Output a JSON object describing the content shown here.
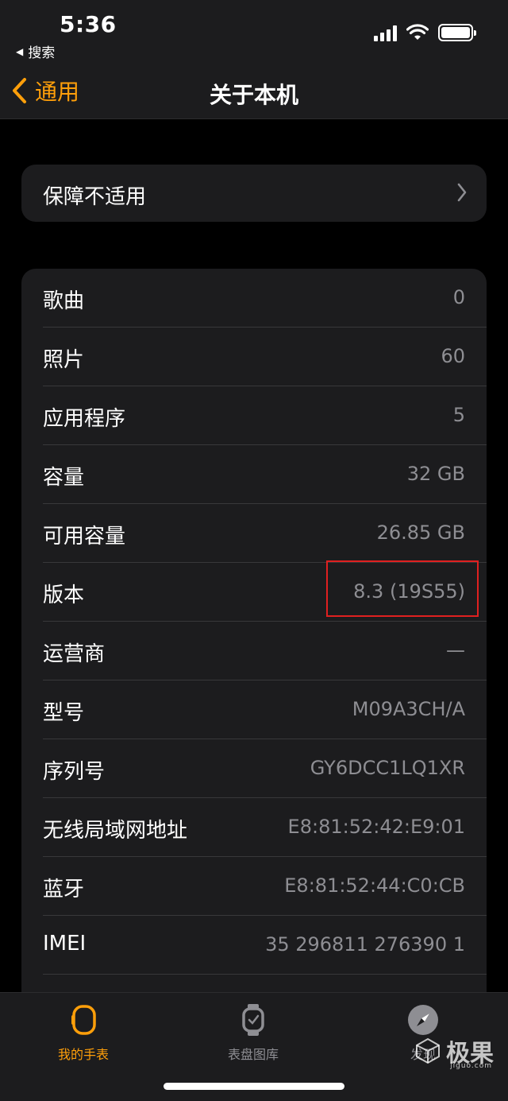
{
  "status": {
    "time": "5:36",
    "back_app": "搜索"
  },
  "nav": {
    "back_label": "通用",
    "title": "关于本机"
  },
  "warranty": {
    "label": "保障不适用"
  },
  "info_rows": [
    {
      "key": "歌曲",
      "value": "0"
    },
    {
      "key": "照片",
      "value": "60"
    },
    {
      "key": "应用程序",
      "value": "5"
    },
    {
      "key": "容量",
      "value": "32 GB"
    },
    {
      "key": "可用容量",
      "value": "26.85 GB"
    },
    {
      "key": "版本",
      "value": "8.3 (19S55)"
    },
    {
      "key": "运营商",
      "value": "—"
    },
    {
      "key": "型号",
      "value": "M09A3CH/A"
    },
    {
      "key": "序列号",
      "value": "GY6DCC1LQ1XR"
    },
    {
      "key": "无线局域网地址",
      "value": "E8:81:52:42:E9:01"
    },
    {
      "key": "蓝牙",
      "value": "E8:81:52:44:C0:CB"
    },
    {
      "key": "IMEI",
      "value": "35 296811 276390 1"
    },
    {
      "key": "",
      "value": ""
    }
  ],
  "tabs": [
    {
      "label": "我的手表",
      "icon": "watch-icon",
      "active": true
    },
    {
      "label": "表盘图库",
      "icon": "watch-face-icon",
      "active": false
    },
    {
      "label": "发现",
      "icon": "compass-icon",
      "active": false
    }
  ],
  "watermark": {
    "text": "极果",
    "sub": "jiguo.com"
  },
  "colors": {
    "accent": "#ff9f0a",
    "highlight": "#e02020",
    "card": "#1c1c1e",
    "secondary_text": "#8e8e93"
  }
}
